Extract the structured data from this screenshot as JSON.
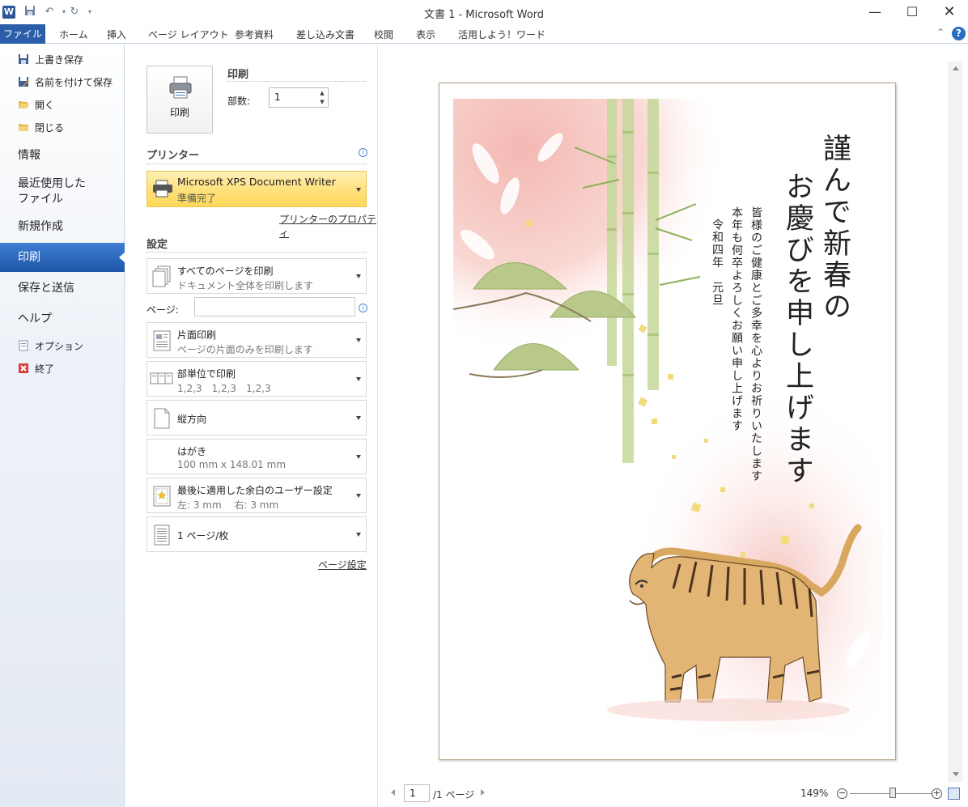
{
  "window": {
    "title": "文書 1 - Microsoft Word",
    "app_icon": "W",
    "quick_access": [
      "save-icon",
      "undo-icon",
      "redo-icon",
      "customize-icon"
    ]
  },
  "ribbon": {
    "file_tab": "ファイル",
    "tabs": [
      "ホーム",
      "挿入",
      "ページ レイアウト",
      "参考資料",
      "差し込み文書",
      "校閲",
      "表示",
      "活用しよう！ワード"
    ],
    "help": "?"
  },
  "backstage": {
    "small_items": [
      {
        "label": "上書き保存",
        "icon": "save-icon"
      },
      {
        "label": "名前を付けて保存",
        "icon": "save-as-icon"
      },
      {
        "label": "開く",
        "icon": "open-folder-icon"
      },
      {
        "label": "閉じる",
        "icon": "close-folder-icon"
      }
    ],
    "info": "情報",
    "recent_line1": "最近使用した",
    "recent_line2": "ファイル",
    "new": "新規作成",
    "print": "印刷",
    "save_send": "保存と送信",
    "help": "ヘルプ",
    "options": "オプション",
    "exit": "終了"
  },
  "print_panel": {
    "print_button": "印刷",
    "print_title": "印刷",
    "copies_label": "部数:",
    "copies_value": "1",
    "printer_title": "プリンター",
    "printer_name": "Microsoft XPS Document Writer",
    "printer_status": "準備完了",
    "printer_props": "プリンターのプロパティ",
    "settings_title": "設定",
    "range_title": "すべてのページを印刷",
    "range_sub": "ドキュメント全体を印刷します",
    "pages_label": "ページ:",
    "pages_value": "",
    "sides_title": "片面印刷",
    "sides_sub": "ページの片面のみを印刷します",
    "collate_title": "部単位で印刷",
    "collate_sub": "1,2,3　1,2,3　1,2,3",
    "orientation": "縦方向",
    "paper_title": "はがき",
    "paper_sub": "100 mm x 148.01 mm",
    "margins_title": "最後に適用した余白のユーザー設定",
    "margins_sub": "左:  3 mm　 右:  3 mm",
    "per_page": "1 ページ/枚",
    "page_setup": "ページ設定"
  },
  "preview": {
    "greeting": [
      "謹んで新春の",
      "お慶びを申し上げます"
    ],
    "message": [
      "皆様のご健康とご多幸を心よりお祈りいたします",
      "本年も何卒よろしくお願い申し上げます",
      "令和四年　元旦"
    ],
    "page_current": "1",
    "page_total": "/1 ページ",
    "zoom": "149%"
  }
}
